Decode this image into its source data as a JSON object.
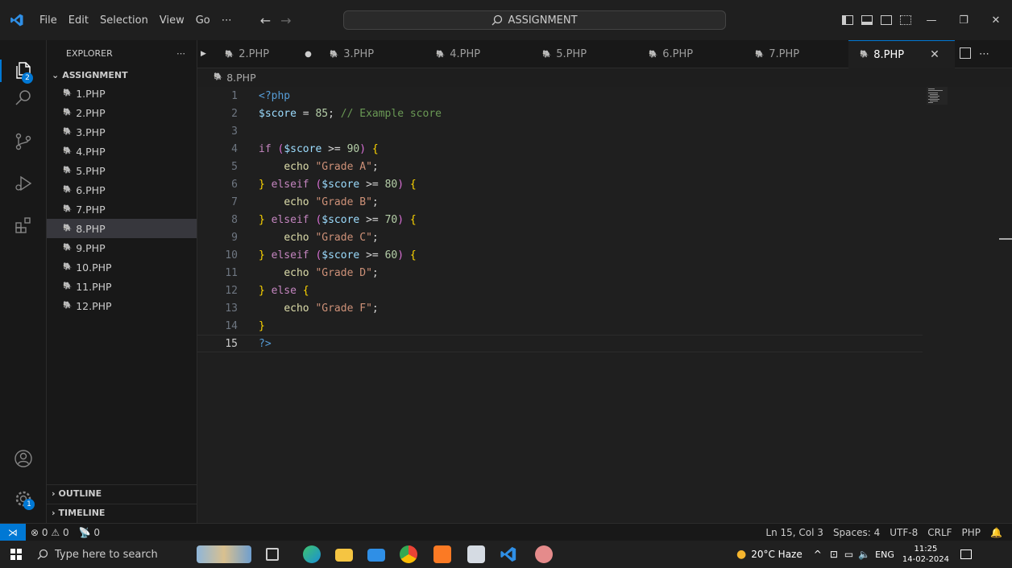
{
  "menu": [
    "File",
    "Edit",
    "Selection",
    "View",
    "Go",
    "⋯"
  ],
  "search": {
    "label": "ASSIGNMENT"
  },
  "sidebar": {
    "header": "EXPLORER",
    "more": "⋯",
    "folder": "ASSIGNMENT",
    "files": [
      "1.PHP",
      "2.PHP",
      "3.PHP",
      "4.PHP",
      "5.PHP",
      "6.PHP",
      "7.PHP",
      "8.PHP",
      "9.PHP",
      "10.PHP",
      "11.PHP",
      "12.PHP"
    ],
    "selected": "8.PHP",
    "outline": "OUTLINE",
    "timeline": "TIMELINE"
  },
  "activity": {
    "explorer_badge": "2",
    "settings_badge": "1"
  },
  "tabs": [
    {
      "label": "2.PHP",
      "modified": true
    },
    {
      "label": "3.PHP"
    },
    {
      "label": "4.PHP"
    },
    {
      "label": "5.PHP"
    },
    {
      "label": "6.PHP"
    },
    {
      "label": "7.PHP"
    },
    {
      "label": "8.PHP",
      "active": true
    }
  ],
  "breadcrumb": "8.PHP",
  "code": {
    "current_line": 15,
    "lines": [
      "<?php",
      "$score = 85; // Example score",
      "",
      "if ($score >= 90) {",
      "    echo \"Grade A\";",
      "} elseif ($score >= 80) {",
      "    echo \"Grade B\";",
      "} elseif ($score >= 70) {",
      "    echo \"Grade C\";",
      "} elseif ($score >= 60) {",
      "    echo \"Grade D\";",
      "} else {",
      "    echo \"Grade F\";",
      "}",
      "?>"
    ]
  },
  "status": {
    "errors": "0",
    "warnings": "0",
    "ports": "0",
    "position": "Ln 15, Col 3",
    "spaces": "Spaces: 4",
    "encoding": "UTF-8",
    "eol": "CRLF",
    "language": "PHP"
  },
  "taskbar": {
    "search_placeholder": "Type here to search",
    "weather": "20°C  Haze",
    "language": "ENG",
    "time": "11:25",
    "date": "14-02-2024"
  },
  "colors": {
    "accent": "#0078d4",
    "php_icon": "#a074c4"
  }
}
